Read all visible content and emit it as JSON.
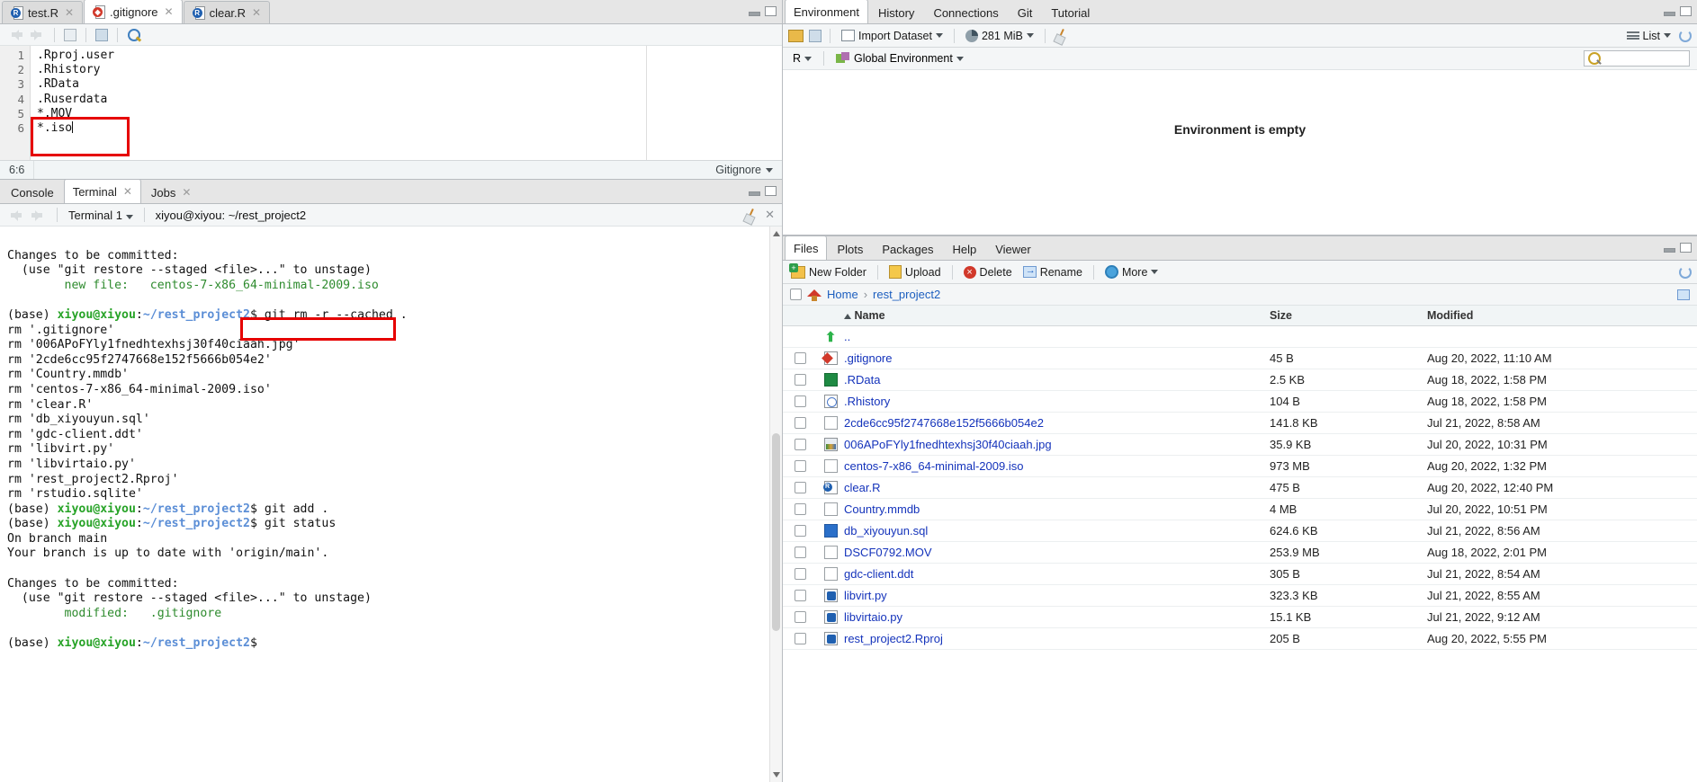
{
  "source": {
    "tabs": [
      {
        "label": "test.R",
        "icon": "r-file-icon",
        "active": false,
        "closable": true
      },
      {
        "label": ".gitignore",
        "icon": "gitignore-file-icon",
        "active": true,
        "closable": true
      },
      {
        "label": "clear.R",
        "icon": "r-file-icon",
        "active": false,
        "closable": true
      }
    ],
    "toolbar": {
      "back": "back-arrow",
      "forward": "forward-arrow",
      "popout": "show-in-new-window",
      "save": "save",
      "find": "find-replace"
    },
    "code_lines": [
      {
        "n": "1",
        "text": ".Rproj.user"
      },
      {
        "n": "2",
        "text": ".Rhistory"
      },
      {
        "n": "3",
        "text": ".RData"
      },
      {
        "n": "4",
        "text": ".Ruserdata"
      },
      {
        "n": "5",
        "text": "*.MOV"
      },
      {
        "n": "6",
        "text": "*.iso"
      }
    ],
    "status": {
      "position": "6:6",
      "file_type": "Gitignore"
    }
  },
  "console": {
    "tabs": [
      {
        "label": "Console",
        "active": false,
        "closable": false
      },
      {
        "label": "Terminal",
        "active": true,
        "closable": true
      },
      {
        "label": "Jobs",
        "active": false,
        "closable": true
      }
    ],
    "terminal_selector": "Terminal 1",
    "terminal_title": "xiyou@xiyou: ~/rest_project2",
    "output": [
      {
        "type": "plain",
        "text": "Changes to be committed:"
      },
      {
        "type": "plain",
        "text": "  (use \"git restore --staged <file>...\" to unstage)"
      },
      {
        "type": "green",
        "text": "        new file:   centos-7-x86_64-minimal-2009.iso"
      },
      {
        "type": "plain",
        "text": ""
      },
      {
        "type": "prompt",
        "prefix": "(base) ",
        "user": "xiyou@xiyou",
        "colon": ":",
        "path": "~/rest_project2",
        "dollar": "$ ",
        "cmd": "git rm -r --cached ."
      },
      {
        "type": "plain",
        "text": "rm '.gitignore'"
      },
      {
        "type": "plain",
        "text": "rm '006APoFYly1fnedhtexhsj30f40ciaah.jpg'"
      },
      {
        "type": "plain",
        "text": "rm '2cde6cc95f2747668e152f5666b054e2'"
      },
      {
        "type": "plain",
        "text": "rm 'Country.mmdb'"
      },
      {
        "type": "plain",
        "text": "rm 'centos-7-x86_64-minimal-2009.iso'"
      },
      {
        "type": "plain",
        "text": "rm 'clear.R'"
      },
      {
        "type": "plain",
        "text": "rm 'db_xiyouyun.sql'"
      },
      {
        "type": "plain",
        "text": "rm 'gdc-client.ddt'"
      },
      {
        "type": "plain",
        "text": "rm 'libvirt.py'"
      },
      {
        "type": "plain",
        "text": "rm 'libvirtaio.py'"
      },
      {
        "type": "plain",
        "text": "rm 'rest_project2.Rproj'"
      },
      {
        "type": "plain",
        "text": "rm 'rstudio.sqlite'"
      },
      {
        "type": "prompt",
        "prefix": "(base) ",
        "user": "xiyou@xiyou",
        "colon": ":",
        "path": "~/rest_project2",
        "dollar": "$ ",
        "cmd": "git add ."
      },
      {
        "type": "prompt",
        "prefix": "(base) ",
        "user": "xiyou@xiyou",
        "colon": ":",
        "path": "~/rest_project2",
        "dollar": "$ ",
        "cmd": "git status"
      },
      {
        "type": "plain",
        "text": "On branch main"
      },
      {
        "type": "plain",
        "text": "Your branch is up to date with 'origin/main'."
      },
      {
        "type": "plain",
        "text": ""
      },
      {
        "type": "plain",
        "text": "Changes to be committed:"
      },
      {
        "type": "plain",
        "text": "  (use \"git restore --staged <file>...\" to unstage)"
      },
      {
        "type": "green",
        "text": "        modified:   .gitignore"
      },
      {
        "type": "plain",
        "text": ""
      },
      {
        "type": "prompt",
        "prefix": "(base) ",
        "user": "xiyou@xiyou",
        "colon": ":",
        "path": "~/rest_project2",
        "dollar": "$",
        "cmd": ""
      }
    ]
  },
  "environment": {
    "tabs": [
      {
        "label": "Environment",
        "active": true
      },
      {
        "label": "History",
        "active": false
      },
      {
        "label": "Connections",
        "active": false
      },
      {
        "label": "Git",
        "active": false
      },
      {
        "label": "Tutorial",
        "active": false
      }
    ],
    "toolbar": {
      "open": "open-folder-icon",
      "save": "save-icon",
      "import_dataset": "Import Dataset",
      "memory": "281 MiB",
      "clear": "broom-icon",
      "list_view": "List",
      "refresh": "refresh-icon"
    },
    "selectors": {
      "language": "R",
      "scope": "Global Environment"
    },
    "search_placeholder": "",
    "empty_message": "Environment is empty"
  },
  "files": {
    "tabs": [
      {
        "label": "Files",
        "active": true
      },
      {
        "label": "Plots",
        "active": false
      },
      {
        "label": "Packages",
        "active": false
      },
      {
        "label": "Help",
        "active": false
      },
      {
        "label": "Viewer",
        "active": false
      }
    ],
    "toolbar": [
      {
        "label": "New Folder",
        "icon": "new-folder-icon"
      },
      {
        "label": "Upload",
        "icon": "upload-icon"
      },
      {
        "label": "Delete",
        "icon": "delete-icon"
      },
      {
        "label": "Rename",
        "icon": "rename-icon"
      },
      {
        "label": "More",
        "icon": "gear-icon"
      }
    ],
    "breadcrumb": [
      "Home",
      "rest_project2"
    ],
    "columns": [
      "Name",
      "Size",
      "Modified"
    ],
    "sort_indicator": "ascending",
    "rows": [
      {
        "icon": "parent-dir-icon",
        "name": "..",
        "size": "",
        "modified": "",
        "parent": true
      },
      {
        "icon": "gitignore-file-icon",
        "name": ".gitignore",
        "size": "45 B",
        "modified": "Aug 20, 2022, 11:10 AM"
      },
      {
        "icon": "rdata-file-icon",
        "name": ".RData",
        "size": "2.5 KB",
        "modified": "Aug 18, 2022, 1:58 PM"
      },
      {
        "icon": "rhistory-file-icon",
        "name": ".Rhistory",
        "size": "104 B",
        "modified": "Aug 18, 2022, 1:58 PM"
      },
      {
        "icon": "generic-file-icon",
        "name": "2cde6cc95f2747668e152f5666b054e2",
        "size": "141.8 KB",
        "modified": "Jul 21, 2022, 8:58 AM"
      },
      {
        "icon": "image-file-icon",
        "name": "006APoFYly1fnedhtexhsj30f40ciaah.jpg",
        "size": "35.9 KB",
        "modified": "Jul 20, 2022, 10:31 PM"
      },
      {
        "icon": "generic-file-icon",
        "name": "centos-7-x86_64-minimal-2009.iso",
        "size": "973 MB",
        "modified": "Aug 20, 2022, 1:32 PM"
      },
      {
        "icon": "r-file-icon",
        "name": "clear.R",
        "size": "475 B",
        "modified": "Aug 20, 2022, 12:40 PM"
      },
      {
        "icon": "generic-file-icon",
        "name": "Country.mmdb",
        "size": "4 MB",
        "modified": "Jul 20, 2022, 10:51 PM"
      },
      {
        "icon": "sql-file-icon",
        "name": "db_xiyouyun.sql",
        "size": "624.6 KB",
        "modified": "Jul 21, 2022, 8:56 AM"
      },
      {
        "icon": "generic-file-icon",
        "name": "DSCF0792.MOV",
        "size": "253.9 MB",
        "modified": "Aug 18, 2022, 2:01 PM"
      },
      {
        "icon": "generic-file-icon",
        "name": "gdc-client.ddt",
        "size": "305 B",
        "modified": "Jul 21, 2022, 8:54 AM"
      },
      {
        "icon": "python-file-icon",
        "name": "libvirt.py",
        "size": "323.3 KB",
        "modified": "Jul 21, 2022, 8:55 AM"
      },
      {
        "icon": "python-file-icon",
        "name": "libvirtaio.py",
        "size": "15.1 KB",
        "modified": "Jul 21, 2022, 9:12 AM"
      },
      {
        "icon": "rproj-file-icon",
        "name": "rest_project2.Rproj",
        "size": "205 B",
        "modified": "Aug 20, 2022, 5:55 PM"
      }
    ]
  },
  "annotations": {
    "accent_red": "#e60000",
    "boxes": [
      {
        "name": "gitignore-iso-line-highlight"
      },
      {
        "name": "git-rm-cached-command-highlight"
      }
    ]
  }
}
